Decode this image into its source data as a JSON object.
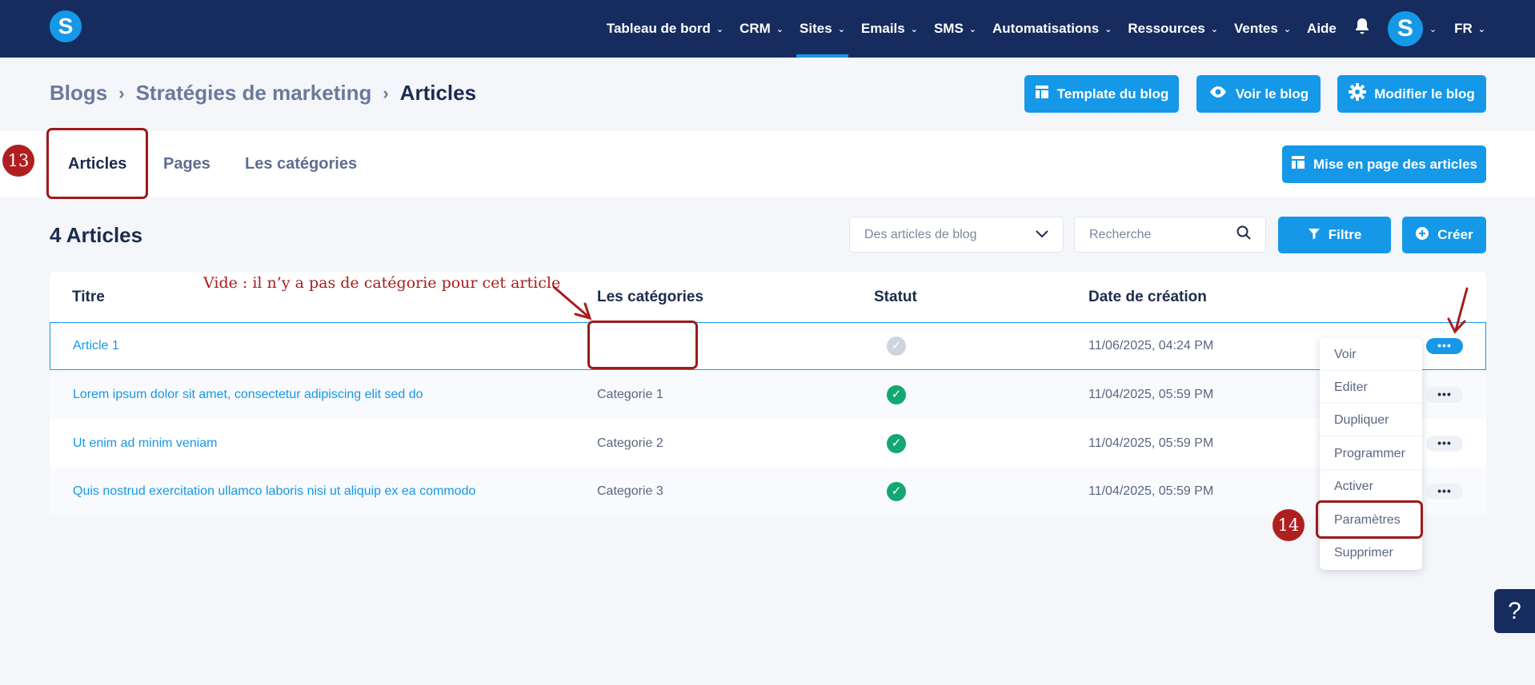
{
  "nav": {
    "items": [
      {
        "label": "Tableau de bord",
        "chevron": true,
        "active": false
      },
      {
        "label": "CRM",
        "chevron": true,
        "active": false
      },
      {
        "label": "Sites",
        "chevron": true,
        "active": true
      },
      {
        "label": "Emails",
        "chevron": true,
        "active": false
      },
      {
        "label": "SMS",
        "chevron": true,
        "active": false
      },
      {
        "label": "Automatisations",
        "chevron": true,
        "active": false
      },
      {
        "label": "Ressources",
        "chevron": true,
        "active": false
      },
      {
        "label": "Ventes",
        "chevron": true,
        "active": false
      },
      {
        "label": "Aide",
        "chevron": false,
        "active": false
      }
    ],
    "logo_letter": "S",
    "avatar_letter": "S",
    "language": "FR"
  },
  "breadcrumb": {
    "items": [
      "Blogs",
      "Stratégies de marketing",
      "Articles"
    ]
  },
  "header_buttons": {
    "template": "Template du blog",
    "view": "Voir le blog",
    "edit": "Modifier le blog"
  },
  "tabs": {
    "items": [
      "Articles",
      "Pages",
      "Les catégories"
    ],
    "active": "Articles",
    "layout_button": "Mise en page des articles"
  },
  "list": {
    "count_label": "4 Articles",
    "filter_select": "Des articles de blog",
    "search_placeholder": "Recherche",
    "filter_button": "Filtre",
    "create_button": "Créer"
  },
  "table": {
    "headers": [
      "Titre",
      "Les catégories",
      "Statut",
      "Date de création"
    ],
    "rows": [
      {
        "title": "Article 1",
        "category": "",
        "published": false,
        "date": "11/06/2025, 04:24 PM"
      },
      {
        "title": "Lorem ipsum dolor sit amet, consectetur adipiscing elit sed do",
        "category": "Categorie 1",
        "published": true,
        "date": "11/04/2025, 05:59 PM"
      },
      {
        "title": "Ut enim ad minim veniam",
        "category": "Categorie 2",
        "published": true,
        "date": "11/04/2025, 05:59 PM"
      },
      {
        "title": "Quis nostrud exercitation ullamco laboris nisi ut aliquip ex ea commodo",
        "category": "Categorie 3",
        "published": true,
        "date": "11/04/2025, 05:59 PM"
      }
    ],
    "row_menu_label": "•••"
  },
  "context_menu": {
    "items": [
      "Voir",
      "Editer",
      "Dupliquer",
      "Programmer",
      "Activer",
      "Paramètres",
      "Supprimer"
    ]
  },
  "annotations": {
    "step_13": "13",
    "step_14": "14",
    "note": "Vide : il n’y a pas de catégorie pour cet article",
    "color": "#a81c1c"
  },
  "help_label": "?",
  "colors": {
    "topbar": "#162c5f",
    "accent": "#1598e8",
    "published": "#13a774"
  }
}
